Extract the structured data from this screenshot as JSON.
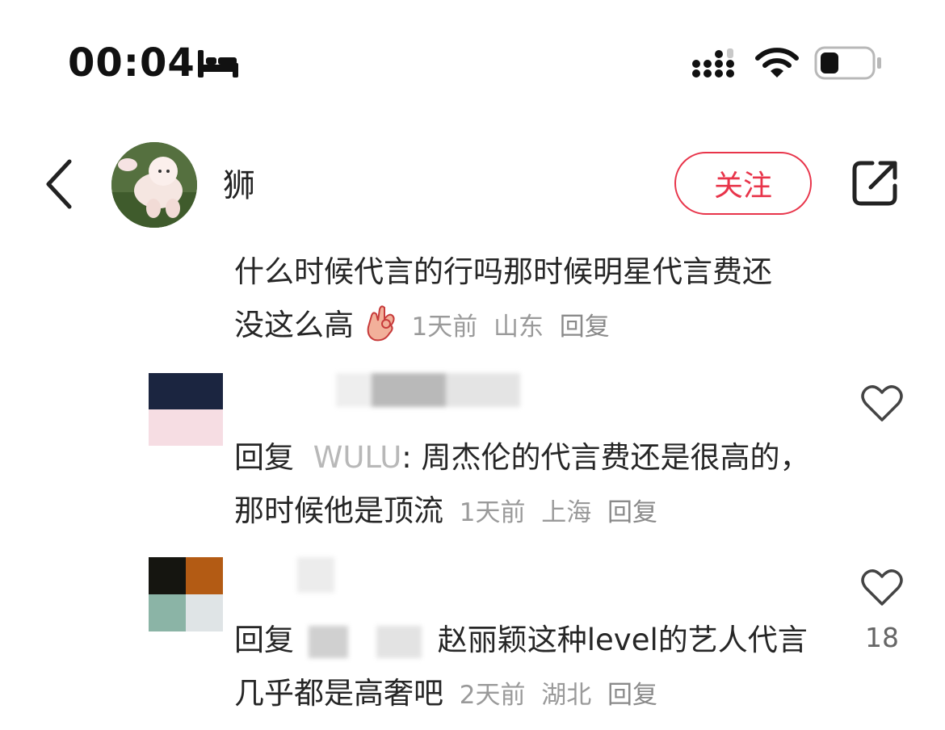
{
  "status_bar": {
    "time": "00:04",
    "sleep_icon": "bed-icon",
    "signal_icon": "cellular-signal-icon",
    "wifi_icon": "wifi-icon",
    "battery_icon": "battery-icon"
  },
  "header": {
    "back_icon": "chevron-left-icon",
    "author_name": "狮",
    "follow_label": "关注",
    "share_icon": "share-icon",
    "accent_color": "#e8344a"
  },
  "main_comment": {
    "text": "什么时候代言的行吗那时候明星代言费还没这么高",
    "emoji": "ok-hand-emoji",
    "time": "1天前",
    "location": "山东",
    "reply_label": "回复"
  },
  "replies": [
    {
      "reply_prefix": "回复",
      "reply_to": "WULU",
      "text": ": 周杰伦的代言费还是很高的，那时候他是顶流",
      "time": "1天前",
      "location": "上海",
      "reply_label": "回复",
      "likes": ""
    },
    {
      "reply_prefix": "回复",
      "reply_to": "",
      "text": "赵丽颖这种level的艺人代言几乎都是高奢吧",
      "time": "2天前",
      "location": "湖北",
      "reply_label": "回复",
      "likes": "18"
    }
  ]
}
